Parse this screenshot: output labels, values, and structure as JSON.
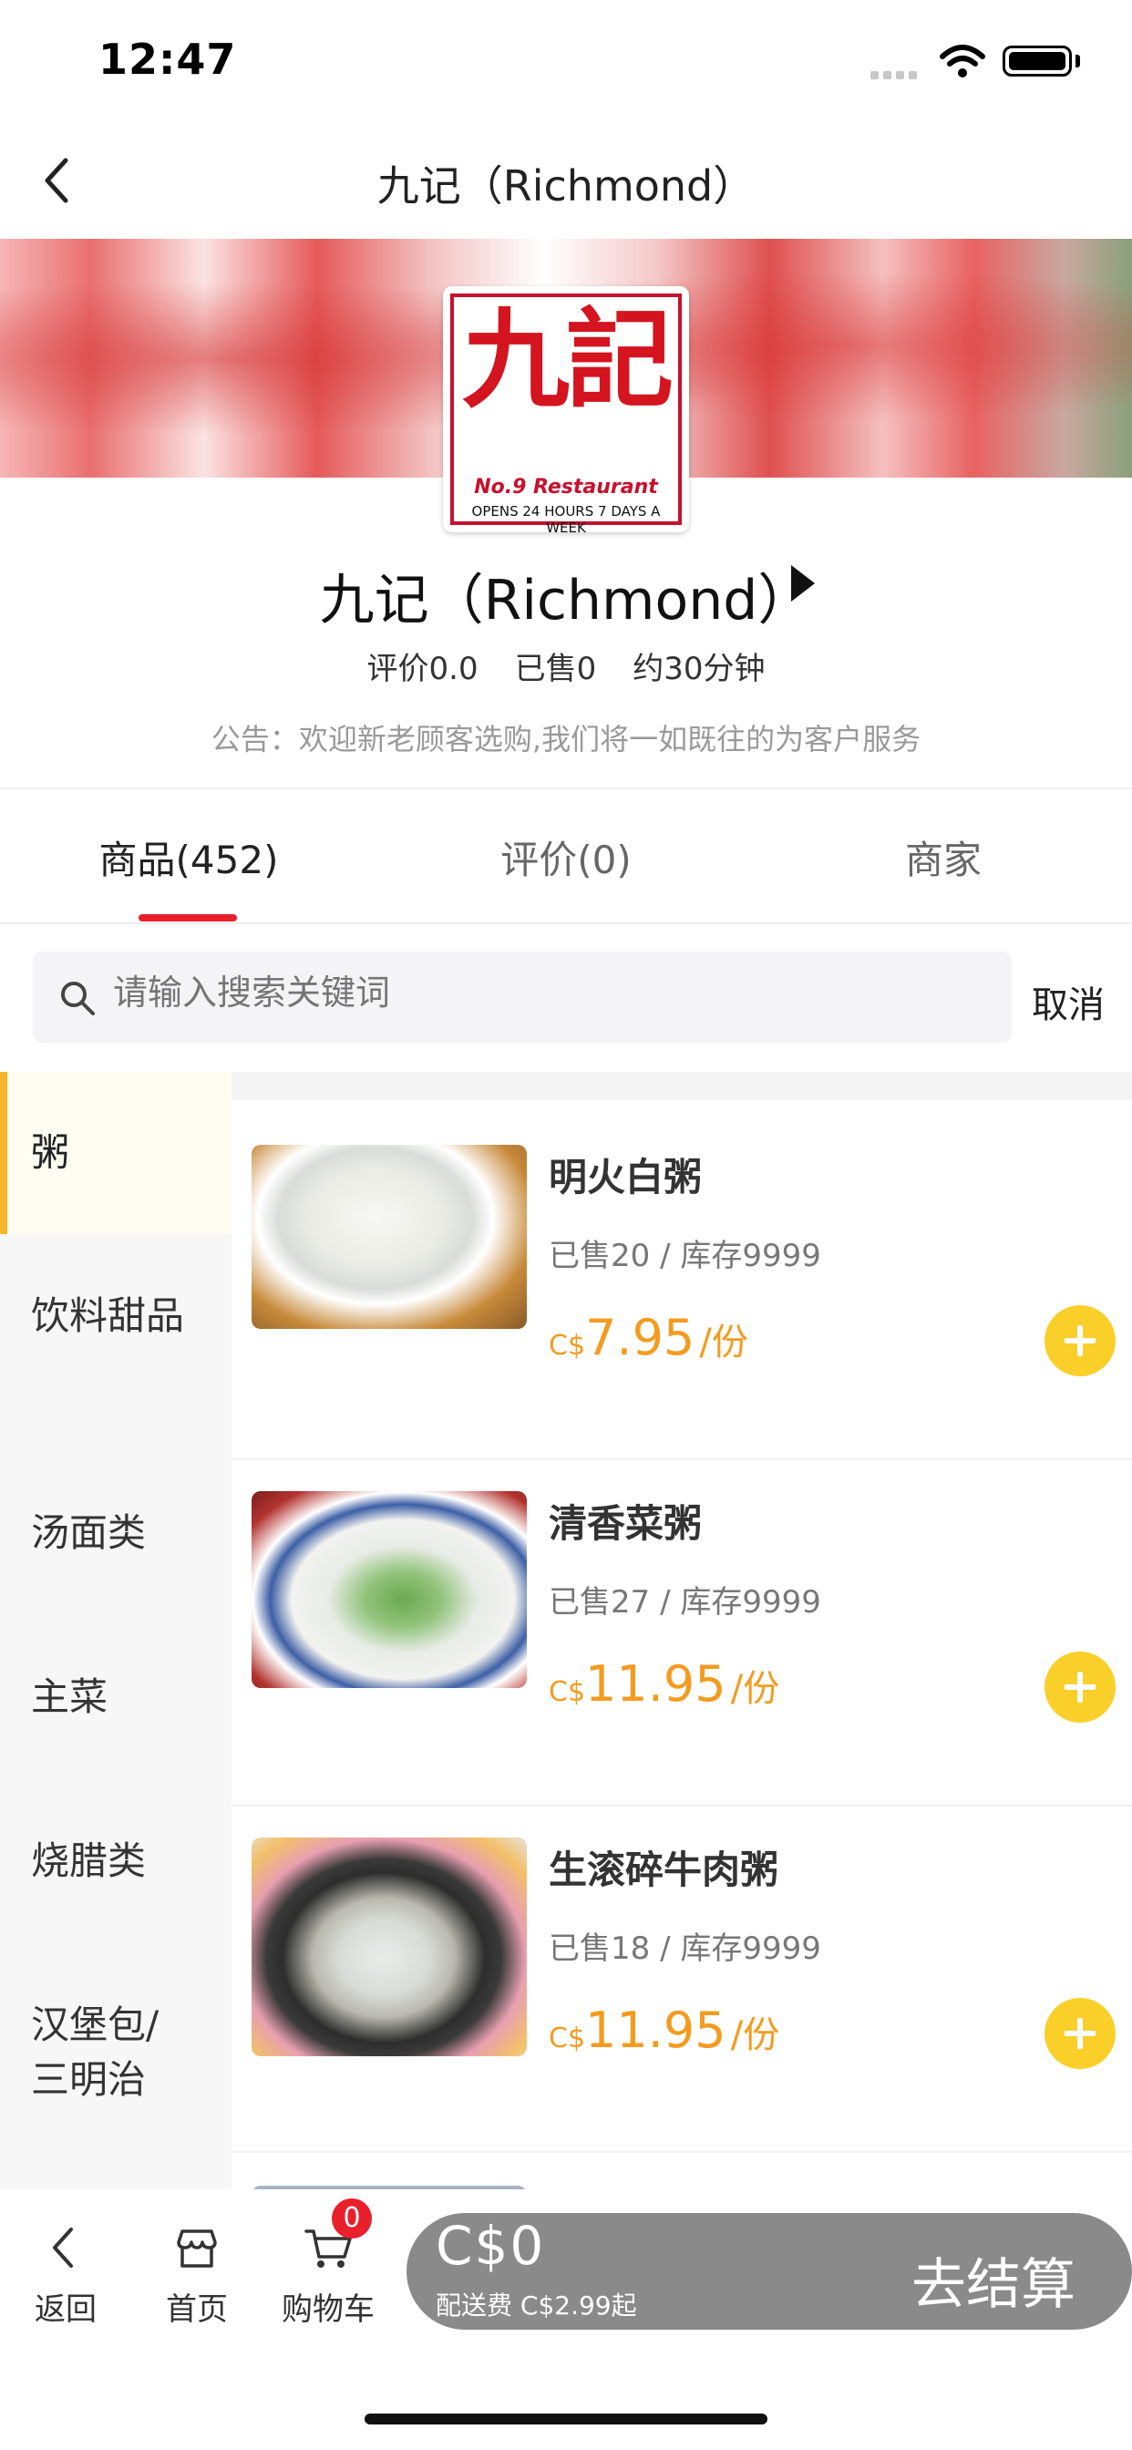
{
  "status_bar": {
    "time": "12:47"
  },
  "nav": {
    "title": "九记（Richmond）"
  },
  "store": {
    "logo": {
      "cn": "九記",
      "en": "No.9 Restaurant",
      "hours": "OPENS 24 HOURS 7 DAYS A WEEK"
    },
    "name": "九记（Richmond）",
    "rating": "评价0.0",
    "sold": "已售0",
    "delivery_time": "约30分钟",
    "notice": "公告：欢迎新老顾客选购,我们将一如既往的为客户服务"
  },
  "tabs": [
    {
      "label": "商品(452)",
      "active": true
    },
    {
      "label": "评价(0)",
      "active": false
    },
    {
      "label": "商家",
      "active": false
    }
  ],
  "search": {
    "placeholder": "请输入搜索关键词",
    "cancel": "取消"
  },
  "categories": [
    {
      "label": "粥",
      "active": true
    },
    {
      "label": "饮料甜品"
    },
    {
      "label": "汤面类"
    },
    {
      "label": "主菜"
    },
    {
      "label": "烧腊类"
    },
    {
      "label": "汉堡包/三明治"
    }
  ],
  "products": [
    {
      "name": "明火白粥",
      "sold": "已售20",
      "stock": "库存9999",
      "currency": "C$",
      "price": "7.95",
      "unit": "/份"
    },
    {
      "name": "清香菜粥",
      "sold": "已售27",
      "stock": "库存9999",
      "currency": "C$",
      "price": "11.95",
      "unit": "/份"
    },
    {
      "name": "生滚碎牛肉粥",
      "sold": "已售18",
      "stock": "库存9999",
      "currency": "C$",
      "price": "11.95",
      "unit": "/份"
    }
  ],
  "bottom_bar": {
    "back": "返回",
    "home": "首页",
    "cart": "购物车",
    "cart_count": "0",
    "amount": "C$0",
    "delivery_fee": "配送费 C$2.99起",
    "checkout": "去结算"
  },
  "colors": {
    "accent_red": "#e8202b",
    "price_orange": "#f49b1f",
    "add_yellow": "#fbcf2a",
    "category_indicator": "#f7b52b",
    "checkout_gray": "#8a8a8a"
  }
}
